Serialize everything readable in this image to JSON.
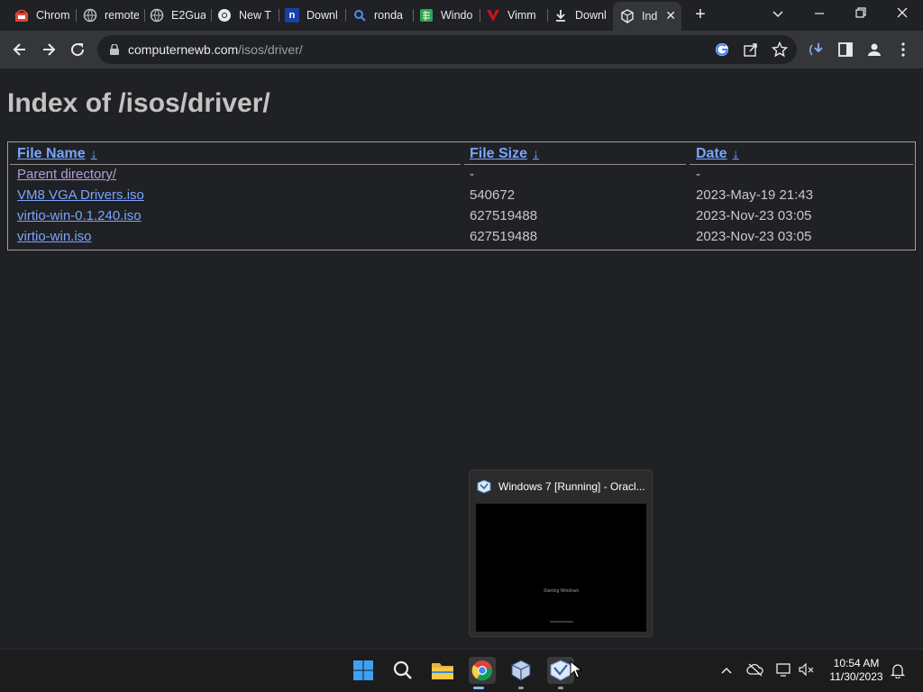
{
  "browser": {
    "tabs": [
      {
        "label": "Chrom",
        "icon": "chrome-web-store-icon",
        "color": "#e94235"
      },
      {
        "label": "remote",
        "icon": "globe-icon",
        "color": "#9aa0a6"
      },
      {
        "label": "E2Gua",
        "icon": "globe-icon",
        "color": "#9aa0a6"
      },
      {
        "label": "New T",
        "icon": "chrome-icon",
        "color": "#e8eaed"
      },
      {
        "label": "Downl",
        "icon": "n-logo-icon",
        "color": "#1a3fa6"
      },
      {
        "label": "ronda",
        "icon": "search-icon",
        "color": "#4f8bf5"
      },
      {
        "label": "Windo",
        "icon": "sheet-icon",
        "color": "#2ea44f"
      },
      {
        "label": "Vimm",
        "icon": "vimm-icon",
        "color": "#c4161c"
      },
      {
        "label": "Downl",
        "icon": "download-icon",
        "color": "#e8eaed"
      },
      {
        "label": "Ind",
        "icon": "virtualbox-icon",
        "color": "#e8eaed",
        "active": true
      }
    ],
    "new_tab": "+",
    "url": {
      "host": "computernewb.com",
      "path": "/isos/driver/"
    }
  },
  "page": {
    "title": "Index of /isos/driver/",
    "columns": {
      "name": "File Name",
      "size": "File Size",
      "date": "Date",
      "sort_arrow": "↓"
    },
    "rows": [
      {
        "name": "Parent directory/",
        "size": "-",
        "date": "-",
        "visited": true
      },
      {
        "name": "VM8 VGA Drivers.iso",
        "size": "540672",
        "date": "2023-May-19 21:43",
        "visited": false
      },
      {
        "name": "virtio-win-0.1.240.iso",
        "size": "627519488",
        "date": "2023-Nov-23 03:05",
        "visited": false
      },
      {
        "name": "virtio-win.iso",
        "size": "627519488",
        "date": "2023-Nov-23 03:05",
        "visited": false
      }
    ]
  },
  "preview": {
    "title": "Windows 7 [Running] - Oracl...",
    "thumb_text": "Starting Windows"
  },
  "taskbar": {
    "apps": [
      "start-icon",
      "search-icon",
      "file-explorer-icon",
      "chrome-icon",
      "virtualbox-icon",
      "virtualbox-vm-icon"
    ],
    "clock": {
      "time": "10:54 AM",
      "date": "11/30/2023"
    }
  },
  "colors": {
    "link": "#7aa5ff",
    "visited": "#b39ddb",
    "page_bg": "#202124"
  }
}
